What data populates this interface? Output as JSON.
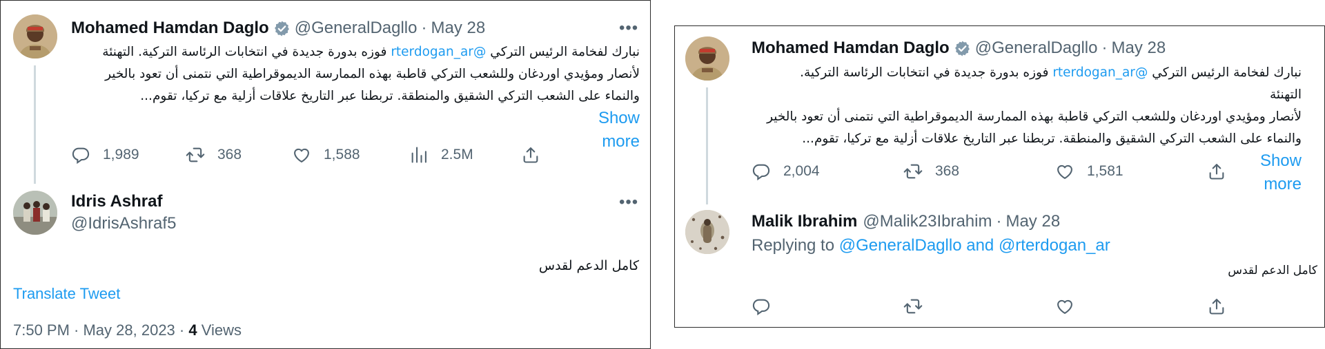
{
  "left_panel": {
    "tweet": {
      "author_name": "Mohamed Hamdan Daglo",
      "author_handle": "@GeneralDagllo",
      "separator": "·",
      "date": "May 28",
      "text_line1_before": "نبارك لفخامة الرئيس التركي",
      "text_mention": "@rterdogan_ar",
      "text_line1_after": "فوزه بدورة جديدة في انتخابات الرئاسة التركية.  التهنئة",
      "text_line2": "لأنصار ومؤيدي اوردغان وللشعب التركي قاطبة بهذه الممارسة الديموقراطية التي نتمنى أن تعود بالخير",
      "text_line3": "والنماء على الشعب التركي الشقيق والمنطقة. تربطنا عبر التاريخ علاقات أزلية مع تركيا، تقوم...",
      "show_more_1": "Show",
      "show_more_2": "more",
      "replies": "1,989",
      "retweets": "368",
      "likes": "1,588",
      "views": "2.5M"
    },
    "reply": {
      "author_name": "Idris Ashraf",
      "author_handle": "@IdrisAshraf5",
      "text": "كامل الدعم لقدس",
      "translate": "Translate Tweet",
      "time": "7:50 PM · May 28, 2023 · ",
      "views_count": "4",
      "views_label": " Views"
    }
  },
  "right_panel": {
    "tweet": {
      "author_name": "Mohamed Hamdan Daglo",
      "author_handle": "@GeneralDagllo",
      "separator": "·",
      "date": "May 28",
      "text_line1_before": "نبارك لفخامة الرئيس التركي",
      "text_mention": "@rterdogan_ar",
      "text_line1_after": "فوزه بدورة جديدة في انتخابات الرئاسة التركية.  التهنئة",
      "text_line2": "لأنصار ومؤيدي اوردغان وللشعب التركي قاطبة بهذه الممارسة الديموقراطية التي نتمنى أن تعود بالخير",
      "text_line3": "والنماء على الشعب التركي الشقيق والمنطقة. تربطنا عبر التاريخ علاقات أزلية مع تركيا، تقوم...",
      "show_more_1": "Show",
      "show_more_2": "more",
      "replies": "2,004",
      "retweets": "368",
      "likes": "1,581"
    },
    "reply": {
      "author_name": "Malik Ibrahim",
      "author_handle": "@Malik23Ibrahim",
      "separator": "·",
      "date": "May 28",
      "replying_prefix": "Replying to ",
      "replying_to_1": "@GeneralDagllo",
      "replying_and": " and ",
      "replying_to_2": "@rterdogan_ar",
      "text": "كامل الدعم لقدس"
    }
  },
  "icons": {
    "more": "more-dots-icon",
    "verified": "verified-badge-icon",
    "reply": "reply-icon",
    "retweet": "retweet-icon",
    "like": "like-icon",
    "views": "views-icon",
    "share": "share-icon"
  },
  "colors": {
    "link": "#1d9bf0",
    "muted": "#536471",
    "text": "#0f1419",
    "thread_line": "#cfd9de"
  }
}
